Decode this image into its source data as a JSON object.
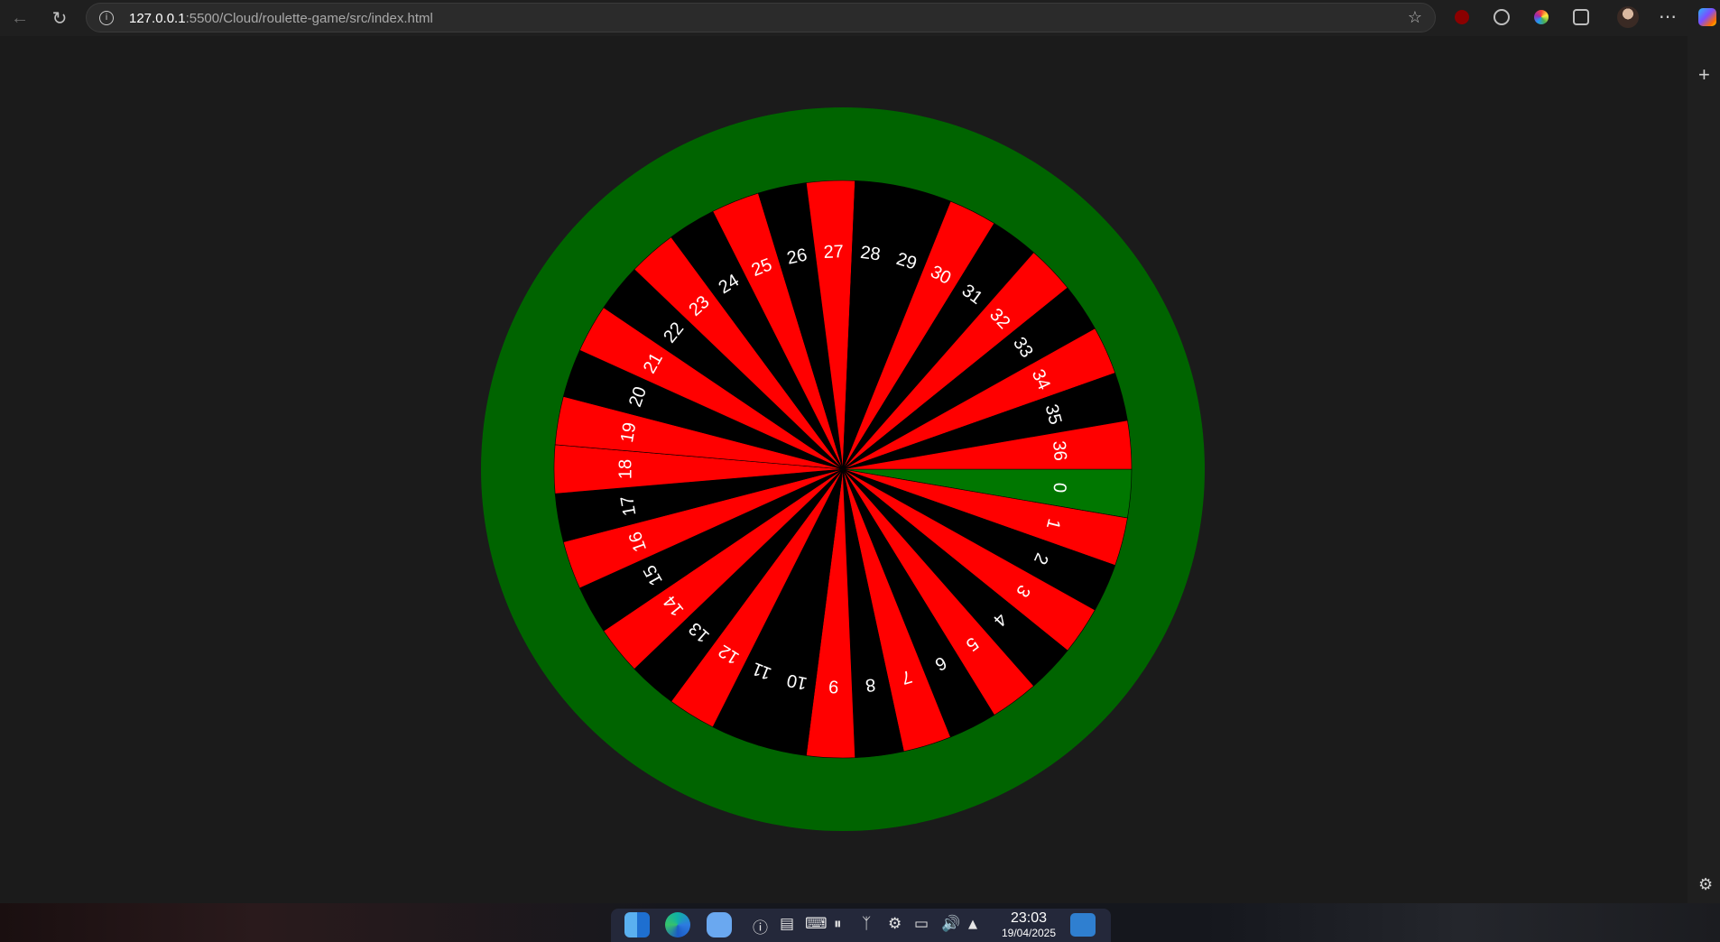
{
  "browser": {
    "url_host": "127.0.0.1",
    "url_path": ":5500/Cloud/roulette-game/src/index.html",
    "back_icon": "back-arrow-icon",
    "reload_icon": "reload-icon",
    "favorite_icon": "star-icon",
    "menu_icon": "more-dots-icon",
    "extensions": [
      "ublock-icon",
      "extension-icon",
      "color-picker-icon",
      "puzzle-icon",
      "profile-avatar"
    ],
    "sidebar": {
      "add_icon": "plus-icon",
      "settings_icon": "gear-icon"
    }
  },
  "wheel": {
    "colors": {
      "red": "#ff0000",
      "black": "#000000",
      "green": "#007700",
      "rim": "#006400",
      "text": "#ffffff"
    },
    "pockets": [
      {
        "number": "0",
        "color": "green"
      },
      {
        "number": "1",
        "color": "red"
      },
      {
        "number": "2",
        "color": "black"
      },
      {
        "number": "3",
        "color": "red"
      },
      {
        "number": "4",
        "color": "black"
      },
      {
        "number": "5",
        "color": "red"
      },
      {
        "number": "6",
        "color": "black"
      },
      {
        "number": "7",
        "color": "red"
      },
      {
        "number": "8",
        "color": "black"
      },
      {
        "number": "9",
        "color": "red"
      },
      {
        "number": "10",
        "color": "black"
      },
      {
        "number": "11",
        "color": "black"
      },
      {
        "number": "12",
        "color": "red"
      },
      {
        "number": "13",
        "color": "black"
      },
      {
        "number": "14",
        "color": "red"
      },
      {
        "number": "15",
        "color": "black"
      },
      {
        "number": "16",
        "color": "red"
      },
      {
        "number": "17",
        "color": "black"
      },
      {
        "number": "18",
        "color": "red"
      },
      {
        "number": "19",
        "color": "red"
      },
      {
        "number": "20",
        "color": "black"
      },
      {
        "number": "21",
        "color": "red"
      },
      {
        "number": "22",
        "color": "black"
      },
      {
        "number": "23",
        "color": "red"
      },
      {
        "number": "24",
        "color": "black"
      },
      {
        "number": "25",
        "color": "red"
      },
      {
        "number": "26",
        "color": "black"
      },
      {
        "number": "27",
        "color": "red"
      },
      {
        "number": "28",
        "color": "black"
      },
      {
        "number": "29",
        "color": "black"
      },
      {
        "number": "30",
        "color": "red"
      },
      {
        "number": "31",
        "color": "black"
      },
      {
        "number": "32",
        "color": "red"
      },
      {
        "number": "33",
        "color": "black"
      },
      {
        "number": "34",
        "color": "red"
      },
      {
        "number": "35",
        "color": "black"
      },
      {
        "number": "36",
        "color": "red"
      }
    ]
  },
  "taskbar": {
    "apps": [
      "finder-icon",
      "edge-icon",
      "files-icon"
    ],
    "tray": [
      "security-icon",
      "clipboard-icon",
      "keyboard-icon",
      "pause-icon",
      "bluetooth-icon",
      "settings-icon",
      "display-icon",
      "volume-icon",
      "chevron-up-icon"
    ],
    "time": "23:03",
    "date": "19/04/2025"
  }
}
